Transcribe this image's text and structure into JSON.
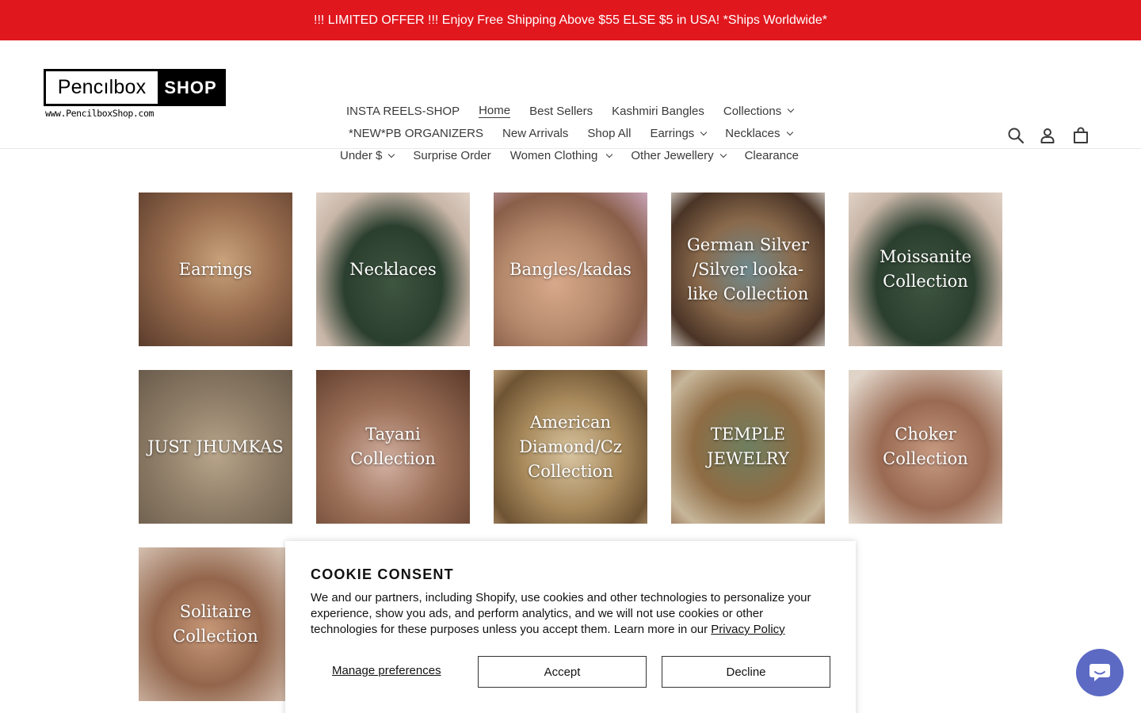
{
  "announcement": "!!! LIMITED OFFER !!! Enjoy Free Shipping Above $55 ELSE $5 in USA! *Ships Worldwide*",
  "logo": {
    "left_text": "Pencılbox",
    "right_text": "SHOP",
    "url_text": "www.PencilboxShop.com"
  },
  "nav": {
    "row1": [
      {
        "label": "INSTA REELS-SHOP"
      },
      {
        "label": "Home"
      },
      {
        "label": "Best Sellers"
      },
      {
        "label": "Kashmiri Bangles"
      },
      {
        "label": "Collections"
      }
    ],
    "row2": [
      {
        "label": "*NEW*PB ORGANIZERS"
      },
      {
        "label": "New Arrivals"
      },
      {
        "label": "Shop All"
      },
      {
        "label": "Earrings"
      },
      {
        "label": "Necklaces"
      }
    ],
    "row3": [
      {
        "label": "Under $"
      },
      {
        "label": "Surprise Order"
      },
      {
        "label": "Women Clothing"
      },
      {
        "label": "Other Jewellery"
      },
      {
        "label": "Clearance"
      }
    ]
  },
  "header_icons": [
    "search-icon",
    "account-icon",
    "cart-icon"
  ],
  "collections": [
    {
      "title": "Earrings"
    },
    {
      "title": "Necklaces"
    },
    {
      "title": "Bangles/kadas"
    },
    {
      "title": "German Silver /Silver looka-like Collection"
    },
    {
      "title": "Moissanite Collection"
    },
    {
      "title": "JUST JHUMKAS"
    },
    {
      "title": "Tayani Collection"
    },
    {
      "title": "American Diamond/Cz Collection"
    },
    {
      "title": "TEMPLE JEWELRY"
    },
    {
      "title": "Choker Collection"
    },
    {
      "title": "Solitaire Collection"
    }
  ],
  "cookie": {
    "title": "COOKIE CONSENT",
    "text": "We and our partners, including Shopify, use cookies and other technologies to personalize your experience, show you ads, and perform analytics, and we will not use cookies or other technologies for these purposes unless you accept them. Learn more in our ",
    "link": "Privacy Policy",
    "manage": "Manage preferences",
    "accept": "Accept",
    "decline": "Decline"
  },
  "colors": {
    "announcement_bg": "#e1171e",
    "chat_bg": "#5c6ac4"
  }
}
